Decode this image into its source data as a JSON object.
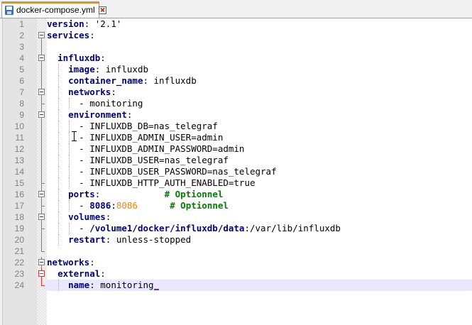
{
  "tab": {
    "filename": "docker-compose.yml"
  },
  "editor": {
    "lines": [
      {
        "n": "1",
        "parts": [
          [
            "k",
            "version"
          ],
          [
            "s",
            ": '2.1'"
          ]
        ]
      },
      {
        "n": "2",
        "parts": [
          [
            "k",
            "services"
          ],
          [
            "s",
            ":"
          ]
        ]
      },
      {
        "n": "3",
        "parts": []
      },
      {
        "n": "4",
        "parts": [
          [
            "s",
            "  "
          ],
          [
            "k",
            "influxdb"
          ],
          [
            "s",
            ":"
          ]
        ]
      },
      {
        "n": "5",
        "parts": [
          [
            "s",
            "    "
          ],
          [
            "k",
            "image"
          ],
          [
            "s",
            ": influxdb"
          ]
        ]
      },
      {
        "n": "6",
        "parts": [
          [
            "s",
            "    "
          ],
          [
            "k",
            "container_name"
          ],
          [
            "s",
            ": influxdb"
          ]
        ]
      },
      {
        "n": "7",
        "parts": [
          [
            "s",
            "    "
          ],
          [
            "k",
            "networks"
          ],
          [
            "s",
            ":"
          ]
        ]
      },
      {
        "n": "8",
        "parts": [
          [
            "s",
            "      - monitoring"
          ]
        ]
      },
      {
        "n": "9",
        "parts": [
          [
            "s",
            "    "
          ],
          [
            "k",
            "environment"
          ],
          [
            "s",
            ":"
          ]
        ]
      },
      {
        "n": "10",
        "parts": [
          [
            "s",
            "      - INFLUXDB_DB=nas_telegraf"
          ]
        ]
      },
      {
        "n": "11",
        "parts": [
          [
            "s",
            "      - INFLUXDB_ADMIN_USER=admin"
          ]
        ]
      },
      {
        "n": "12",
        "parts": [
          [
            "s",
            "      - INFLUXDB_ADMIN_PASSWORD=admin"
          ]
        ]
      },
      {
        "n": "13",
        "parts": [
          [
            "s",
            "      - INFLUXDB_USER=nas_telegraf"
          ]
        ]
      },
      {
        "n": "14",
        "parts": [
          [
            "s",
            "      - INFLUXDB_USER_PASSWORD=nas_telegraf"
          ]
        ]
      },
      {
        "n": "15",
        "parts": [
          [
            "s",
            "      - INFLUXDB_HTTP_AUTH_ENABLED=true"
          ]
        ]
      },
      {
        "n": "16",
        "parts": [
          [
            "s",
            "    "
          ],
          [
            "k",
            "ports"
          ],
          [
            "s",
            ":            "
          ],
          [
            "c",
            "# Optionnel"
          ]
        ]
      },
      {
        "n": "17",
        "parts": [
          [
            "s",
            "      - "
          ],
          [
            "k",
            "8086"
          ],
          [
            "s",
            ":"
          ],
          [
            "n",
            "8086"
          ],
          [
            "s",
            "      "
          ],
          [
            "c",
            "# Optionnel"
          ]
        ]
      },
      {
        "n": "18",
        "parts": [
          [
            "s",
            "    "
          ],
          [
            "k",
            "volumes"
          ],
          [
            "s",
            ":"
          ]
        ]
      },
      {
        "n": "19",
        "parts": [
          [
            "s",
            "      - "
          ],
          [
            "k",
            "/volume1/docker/influxdb/data"
          ],
          [
            "s",
            ":/var/lib/influxdb"
          ]
        ]
      },
      {
        "n": "20",
        "parts": [
          [
            "s",
            "    "
          ],
          [
            "k",
            "restart"
          ],
          [
            "s",
            ": unless-stopped"
          ]
        ]
      },
      {
        "n": "21",
        "parts": []
      },
      {
        "n": "22",
        "parts": [
          [
            "k",
            "networks"
          ],
          [
            "s",
            ":"
          ]
        ]
      },
      {
        "n": "23",
        "parts": [
          [
            "s",
            "  "
          ],
          [
            "k",
            "external"
          ],
          [
            "s",
            ":"
          ]
        ]
      },
      {
        "n": "24",
        "parts": [
          [
            "s",
            "    "
          ],
          [
            "k",
            "name"
          ],
          [
            "s",
            ": monitoring"
          ]
        ]
      }
    ]
  },
  "colors": {
    "keyword": "#000080",
    "number": "#ff8000",
    "comment": "#008000",
    "tab_accent": "#fa8c00",
    "current_line": "#e8e8ff"
  }
}
